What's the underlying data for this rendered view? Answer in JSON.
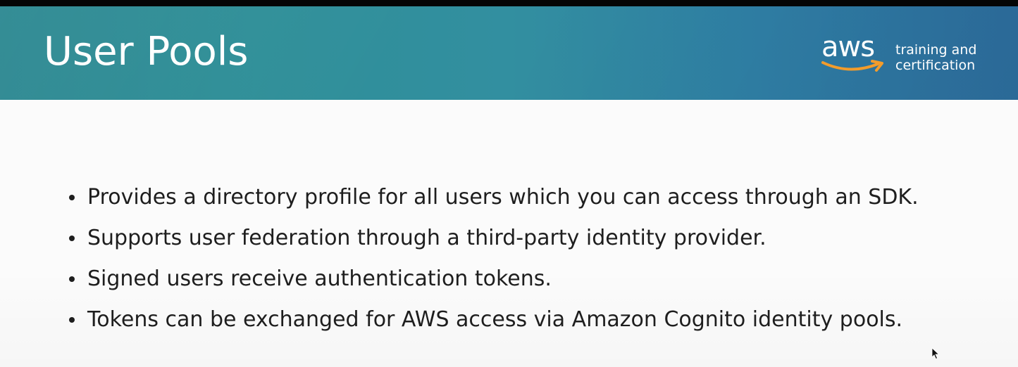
{
  "slide": {
    "title": "User Pools",
    "logo": {
      "wordmark": "aws",
      "tagline_line1": "training and",
      "tagline_line2": "certification",
      "smile_color": "#f39c2b"
    },
    "bullets": [
      "Provides a directory profile for all users which you can access through an SDK.",
      "Supports user federation through a third-party identity provider.",
      "Signed users receive authentication tokens.",
      "Tokens can be exchanged for AWS access via Amazon Cognito identity pools."
    ]
  },
  "colors": {
    "banner_start": "#2a8790",
    "banner_end": "#2d6fa0",
    "content_bg": "#fbfbfb",
    "text": "#1e1e1e"
  },
  "cursor": {
    "icon": "mouse-pointer-icon"
  }
}
